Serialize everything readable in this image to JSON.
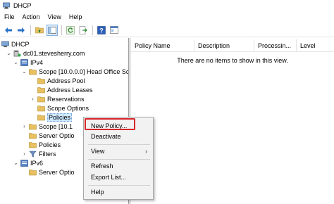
{
  "window": {
    "title": "DHCP",
    "icon": "dhcp-app-icon"
  },
  "menubar": {
    "items": [
      "File",
      "Action",
      "View",
      "Help"
    ]
  },
  "toolbar": {
    "buttons": [
      "back-arrow-icon",
      "forward-arrow-icon",
      "up-folder-icon",
      "show-hide-tree-icon",
      "refresh-icon",
      "export-list-icon",
      "help-icon",
      "properties-icon"
    ]
  },
  "tree": {
    "items": [
      {
        "label": "DHCP",
        "icon": "dhcp-icon"
      },
      {
        "label": "dc01.stevesherry.com",
        "icon": "server-icon"
      },
      {
        "label": "IPv4",
        "icon": "ipv4-icon"
      },
      {
        "label": "Scope [10.0.0.0] Head Office Sco",
        "icon": "folder-icon"
      },
      {
        "label": "Address Pool",
        "icon": "folder-icon"
      },
      {
        "label": "Address Leases",
        "icon": "folder-icon"
      },
      {
        "label": "Reservations",
        "icon": "folder-icon"
      },
      {
        "label": "Scope Options",
        "icon": "folder-icon"
      },
      {
        "label": "Policies",
        "icon": "folder-icon"
      },
      {
        "label": "Scope [10.1",
        "icon": "folder-icon"
      },
      {
        "label": "Server Optio",
        "icon": "folder-icon"
      },
      {
        "label": "Policies",
        "icon": "folder-icon"
      },
      {
        "label": "Filters",
        "icon": "filter-icon"
      },
      {
        "label": "IPv6",
        "icon": "ipv6-icon"
      },
      {
        "label": "Server Optio",
        "icon": "folder-icon"
      }
    ]
  },
  "list": {
    "columns": [
      "Policy Name",
      "Description",
      "Processin...",
      "Level"
    ],
    "empty_message": "There are no items to show in this view."
  },
  "context_menu": {
    "items": [
      "New Policy...",
      "Deactivate",
      "View",
      "Refresh",
      "Export List...",
      "Help"
    ],
    "highlight_color": "#d9252a"
  }
}
